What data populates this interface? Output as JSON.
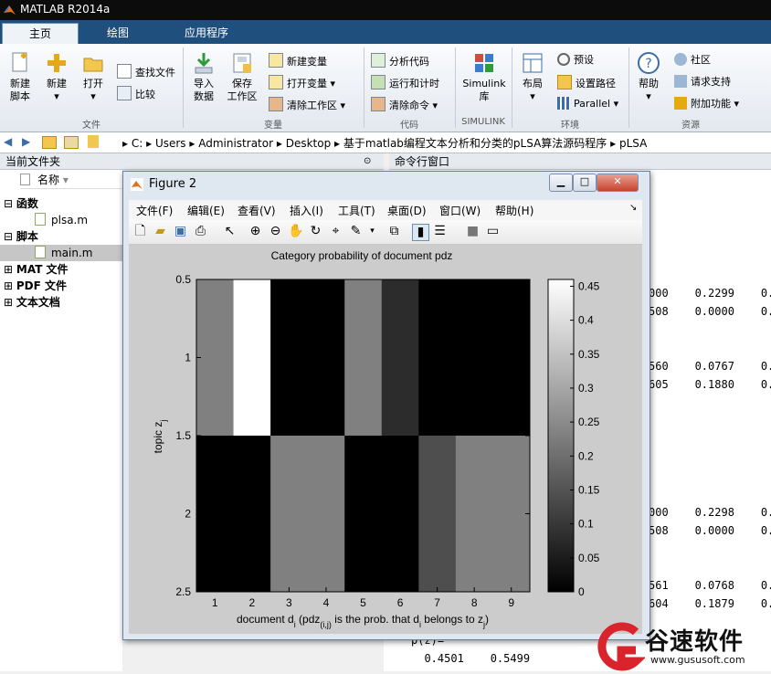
{
  "app": {
    "title": "MATLAB R2014a"
  },
  "tabs": [
    {
      "label": "主页"
    },
    {
      "label": "绘图"
    },
    {
      "label": "应用程序"
    }
  ],
  "ribbon": {
    "file": {
      "new_script": "新建\n脚本",
      "new": "新建",
      "open": "打开",
      "find_files": "查找文件",
      "compare": "比较",
      "group": "文件"
    },
    "variable": {
      "import": "导入\n数据",
      "save": "保存\n工作区",
      "new_var": "新建变量",
      "open_var": "打开变量",
      "clear_ws": "清除工作区",
      "group": "变量"
    },
    "code": {
      "analyze": "分析代码",
      "run_time": "运行和计时",
      "clear_cmd": "清除命令",
      "group": "代码"
    },
    "simulink": {
      "label": "Simulink\n库",
      "group": "SIMULINK"
    },
    "env": {
      "layout": "布局",
      "prefs": "预设",
      "set_path": "设置路径",
      "parallel": "Parallel",
      "group": "环境"
    },
    "resources": {
      "help": "帮助",
      "community": "社区",
      "support": "请求支持",
      "addons": "附加功能",
      "group": "资源"
    }
  },
  "address": {
    "crumbs": [
      "C:",
      "Users",
      "Administrator",
      "Desktop",
      "基于matlab编程文本分析和分类的pLSA算法源码程序",
      "pLSA"
    ]
  },
  "left_pane": {
    "title": "当前文件夹",
    "col_name": "名称",
    "groups": [
      {
        "label": "函数",
        "items": [
          "plsa.m"
        ]
      },
      {
        "label": "脚本",
        "items": [
          "main.m"
        ]
      },
      {
        "label": "MAT 文件",
        "items": []
      },
      {
        "label": "PDF 文件",
        "items": []
      },
      {
        "label": "文本文档",
        "items": []
      }
    ]
  },
  "command_window": {
    "title": "命令行窗口",
    "lines": [
      "000    0.2299    0.",
      "508    0.0000    0.",
      "560    0.0767    0.",
      "605    0.1880    0.",
      "000    0.2298    0.",
      "508    0.0000    0.",
      "561    0.0768    0.",
      "604    0.1879    0.",
      "p(z)=",
      "  0.4501    0.5499"
    ]
  },
  "figure": {
    "title": "Figure 2",
    "menus": [
      "文件(F)",
      "编辑(E)",
      "查看(V)",
      "插入(I)",
      "工具(T)",
      "桌面(D)",
      "窗口(W)",
      "帮助(H)"
    ]
  },
  "colors": {
    "accent": "#1f4f7d",
    "watermark_red": "#d9232d"
  },
  "chart_data": {
    "type": "heatmap",
    "title": "Category probability of document pdz",
    "xlabel": "document d_i (pdz_(i,j) is the prob. that d_i belongs to z_j)",
    "ylabel": "topic z_j",
    "x": [
      1,
      2,
      3,
      4,
      5,
      6,
      7,
      8,
      9
    ],
    "y": [
      1,
      2
    ],
    "x_ticks": [
      "1",
      "2",
      "3",
      "4",
      "5",
      "6",
      "7",
      "8",
      "9"
    ],
    "y_ticks": [
      "0.5",
      "1",
      "1.5",
      "2",
      "2.5"
    ],
    "xlim": [
      0.5,
      9.5
    ],
    "ylim": [
      0.5,
      2.5
    ],
    "colormap": "gray",
    "clim": [
      0,
      0.46
    ],
    "colorbar_ticks": [
      "0.45",
      "0.4",
      "0.35",
      "0.3",
      "0.25",
      "0.2",
      "0.15",
      "0.1",
      "0.05",
      "0"
    ],
    "values": [
      [
        0.23,
        0.46,
        0.0,
        0.0,
        0.23,
        0.08,
        0.0,
        0.0,
        0.0
      ],
      [
        0.0,
        0.0,
        0.23,
        0.23,
        0.0,
        0.0,
        0.14,
        0.23,
        0.23
      ]
    ]
  },
  "watermark": {
    "brand": "谷速软件",
    "url": "www.gususoft.com"
  }
}
